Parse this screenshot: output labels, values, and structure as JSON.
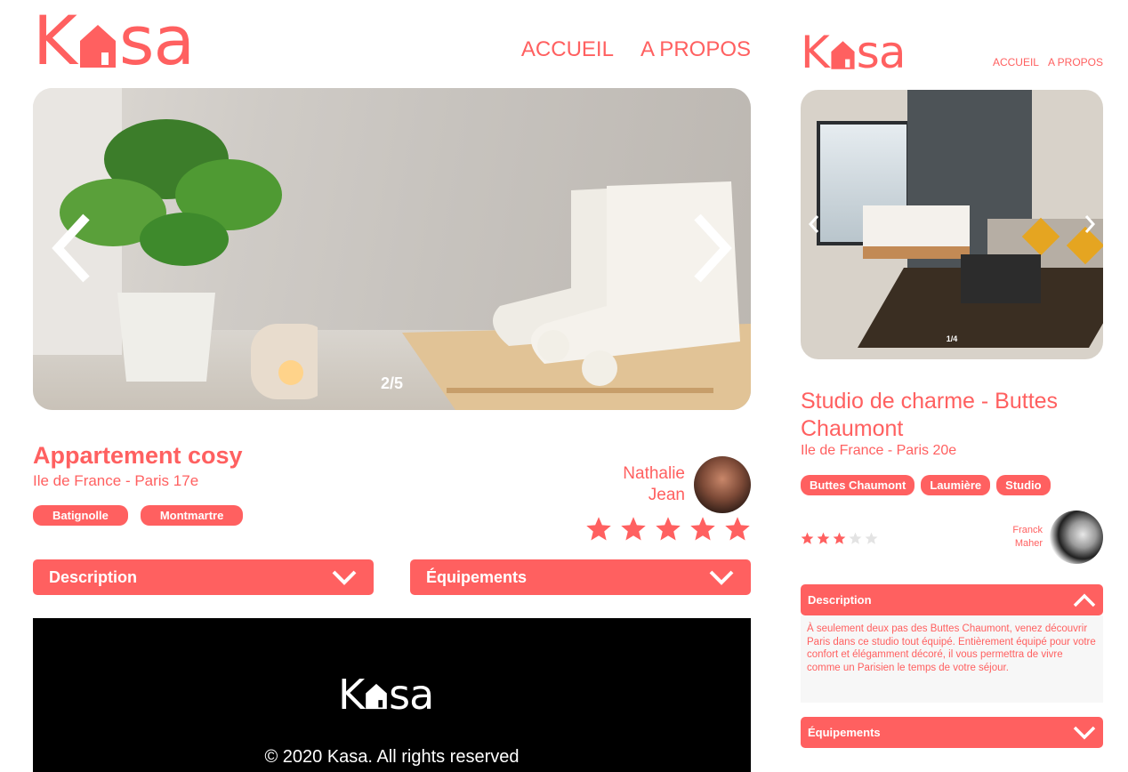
{
  "brand": {
    "logo_k": "K",
    "logo_sa": "sa",
    "primary_color": "#FF6060"
  },
  "desktop": {
    "nav": {
      "home": "ACCUEIL",
      "about": "A PROPOS"
    },
    "slider": {
      "counter": "2/5"
    },
    "listing": {
      "title": "Appartement cosy",
      "location": "Ile de France - Paris 17e",
      "tags": [
        "Batignolle",
        "Montmartre"
      ],
      "host": {
        "first": "Nathalie",
        "last": "Jean"
      },
      "rating": 5,
      "max_rating": 5
    },
    "collapses": {
      "description": "Description",
      "equipments": "Équipements"
    },
    "footer": {
      "copyright": "© 2020 Kasa. All rights reserved"
    }
  },
  "mobile": {
    "nav": {
      "home": "ACCUEIL",
      "about": "A PROPOS"
    },
    "slider": {
      "counter": "1/4"
    },
    "listing": {
      "title": "Studio de charme - Buttes Chaumont",
      "location": "Ile de France - Paris 20e",
      "tags": [
        "Buttes Chaumont",
        "Laumière",
        "Studio"
      ],
      "host": {
        "first": "Franck",
        "last": "Maher"
      },
      "rating": 3,
      "max_rating": 5
    },
    "collapses": {
      "description": "Description",
      "description_text": "À seulement deux pas des Buttes Chaumont, venez découvrir Paris dans ce studio tout équipé. Entièrement équipé pour votre confort et élégamment décoré, il vous permettra de vivre comme un Parisien le temps de votre séjour.",
      "equipments": "Équipements"
    }
  }
}
